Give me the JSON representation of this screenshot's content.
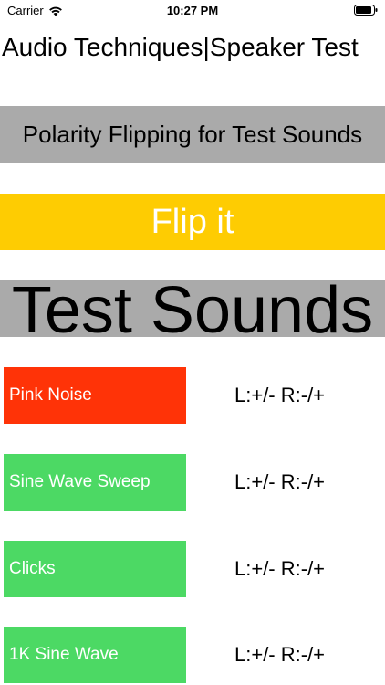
{
  "status_bar": {
    "carrier": "Carrier",
    "time": "10:27 PM",
    "icons": [
      "wifi-icon",
      "battery-icon"
    ]
  },
  "header": {
    "title": "Audio Techniques|Speaker Test"
  },
  "polarity_banner": {
    "text": "Polarity Flipping for Test Sounds"
  },
  "flip_button": {
    "label": "Flip it",
    "color": "#fecc02"
  },
  "test_sounds": {
    "heading": "Test Sounds",
    "items": [
      {
        "label": "Pink Noise",
        "polarity": "L:+/- R:-/+",
        "color": "#ff3307"
      },
      {
        "label": "Sine Wave Sweep",
        "polarity": "L:+/- R:-/+",
        "color": "#4cd964"
      },
      {
        "label": "Clicks",
        "polarity": "L:+/- R:-/+",
        "color": "#4cd964"
      },
      {
        "label": "1K Sine Wave",
        "polarity": "L:+/- R:-/+",
        "color": "#4cd964"
      }
    ]
  }
}
